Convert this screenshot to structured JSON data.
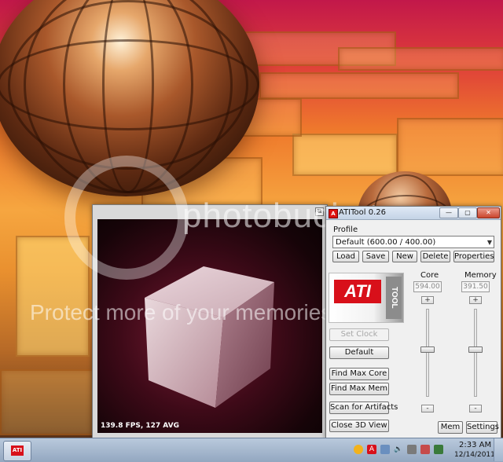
{
  "watermark": {
    "brand": "photobucket",
    "tagline": "Protect more of your memories for less!"
  },
  "view3d": {
    "fps_text": "139.8 FPS, 127 AVG"
  },
  "app": {
    "title": "ATITool 0.26",
    "profile_label": "Profile",
    "profile_selected": "Default (600.00 / 400.00)",
    "buttons": {
      "load": "Load",
      "save": "Save",
      "new": "New",
      "delete": "Delete",
      "properties": "Properties",
      "set_clock": "Set Clock",
      "default": "Default",
      "find_max_core": "Find Max Core",
      "find_max_mem": "Find Max Mem",
      "scan_artifacts": "Scan for Artifacts",
      "close_3d_view": "Close 3D View",
      "mem": "Mem",
      "settings": "Settings"
    },
    "logo": {
      "ati": "ATI",
      "tool": "TOOL"
    },
    "core": {
      "label": "Core",
      "value": "594.00",
      "slider_fraction": 0.46
    },
    "memory": {
      "label": "Memory",
      "value": "391.50",
      "slider_fraction": 0.46
    }
  },
  "taskbar": {
    "time": "2:33 AM",
    "date": "12/14/2011"
  }
}
